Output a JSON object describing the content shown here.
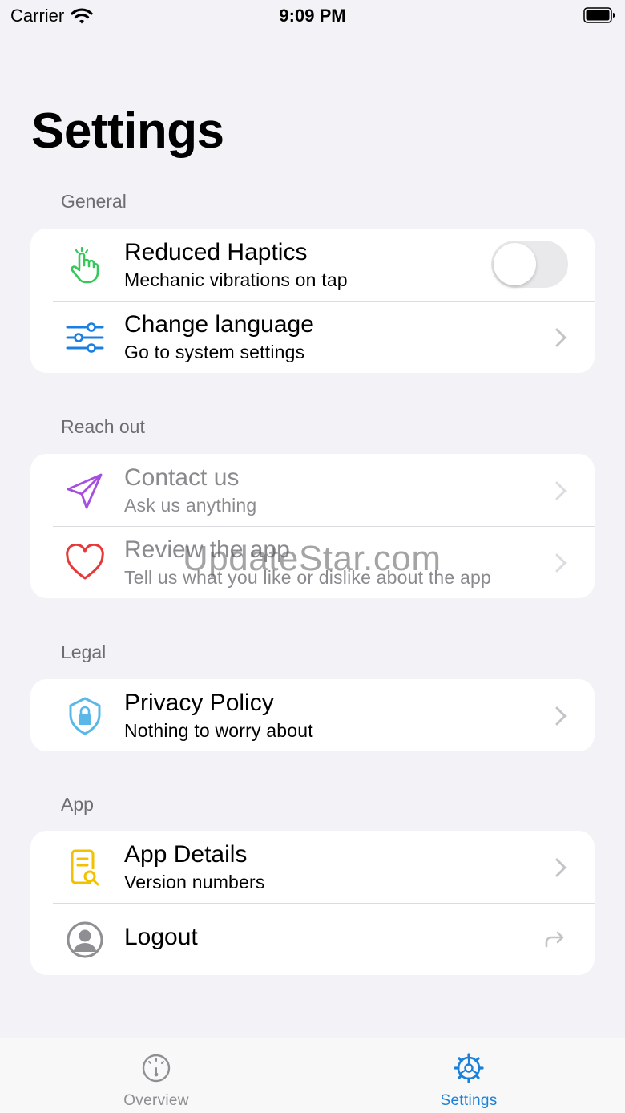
{
  "status_bar": {
    "carrier": "Carrier",
    "time": "9:09 PM"
  },
  "page": {
    "title": "Settings"
  },
  "sections": {
    "general": {
      "header": "General",
      "haptics": {
        "title": "Reduced Haptics",
        "subtitle": "Mechanic vibrations on tap",
        "toggle_on": false,
        "icon": "hand-tap-icon"
      },
      "language": {
        "title": "Change language",
        "subtitle": "Go to system settings",
        "icon": "sliders-icon"
      }
    },
    "reach_out": {
      "header": "Reach out",
      "contact": {
        "title": "Contact us",
        "subtitle": "Ask us anything",
        "icon": "paper-plane-icon"
      },
      "review": {
        "title": "Review the app",
        "subtitle": "Tell us what you like or dislike about the app",
        "icon": "heart-icon"
      }
    },
    "legal": {
      "header": "Legal",
      "privacy": {
        "title": "Privacy Policy",
        "subtitle": "Nothing to worry about",
        "icon": "shield-lock-icon"
      }
    },
    "app": {
      "header": "App",
      "details": {
        "title": "App Details",
        "subtitle": "Version numbers",
        "icon": "document-search-icon"
      },
      "logout": {
        "title": "Logout",
        "icon": "person-circle-icon"
      }
    }
  },
  "watermark": "UpdateStar.com",
  "tab_bar": {
    "tabs": [
      {
        "label": "Overview",
        "icon": "speedometer-icon",
        "selected": false
      },
      {
        "label": "Settings",
        "icon": "gear-icon",
        "selected": true
      }
    ]
  },
  "colors": {
    "background": "#f2f2f7",
    "accent": "#1a80d8",
    "haptics_icon": "#34c759",
    "language_icon": "#1a7fe0",
    "contact_icon": "#a64ee0",
    "review_icon": "#e5393a",
    "privacy_icon": "#5ab8e8",
    "details_icon": "#f2c100",
    "logout_icon": "#8e8e93"
  }
}
